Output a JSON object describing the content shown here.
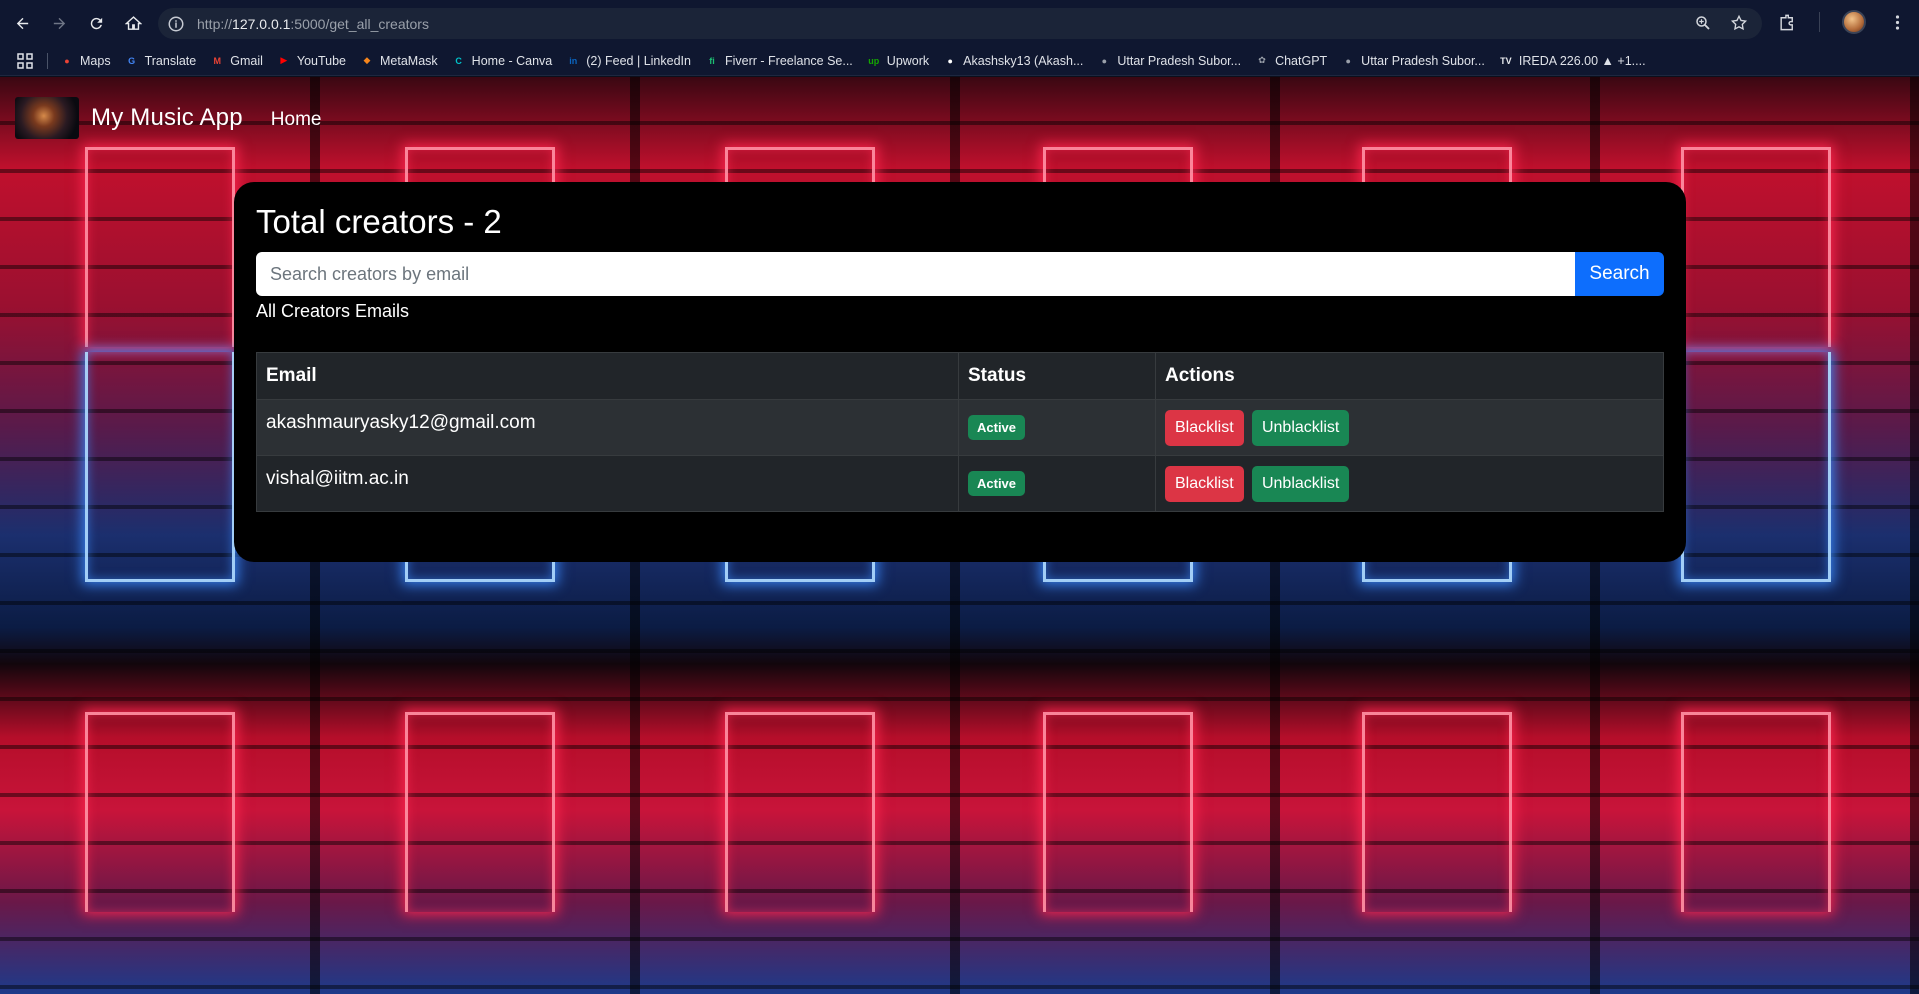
{
  "browser": {
    "url_prefix": "http://",
    "url_host": "127.0.0.1",
    "url_rest": ":5000/get_all_creators",
    "bookmarks": [
      {
        "label": "Maps",
        "color": "#ea4335",
        "glyph": "●"
      },
      {
        "label": "Translate",
        "color": "#4285f4",
        "glyph": "G"
      },
      {
        "label": "Gmail",
        "color": "#ea4335",
        "glyph": "M"
      },
      {
        "label": "YouTube",
        "color": "#ff0000",
        "glyph": "▶"
      },
      {
        "label": "MetaMask",
        "color": "#f6851b",
        "glyph": "◆"
      },
      {
        "label": "Home - Canva",
        "color": "#00c4cc",
        "glyph": "C"
      },
      {
        "label": "(2) Feed | LinkedIn",
        "color": "#0a66c2",
        "glyph": "in"
      },
      {
        "label": "Fiverr - Freelance Se...",
        "color": "#1dbf73",
        "glyph": "fi"
      },
      {
        "label": "Upwork",
        "color": "#14a800",
        "glyph": "up"
      },
      {
        "label": "Akashsky13 (Akash...",
        "color": "#ffffff",
        "glyph": "●"
      },
      {
        "label": "Uttar Pradesh Subor...",
        "color": "#9aa0aa",
        "glyph": "●"
      },
      {
        "label": "ChatGPT",
        "color": "#9aa0aa",
        "glyph": "✿"
      },
      {
        "label": "Uttar Pradesh Subor...",
        "color": "#9aa0aa",
        "glyph": "●"
      },
      {
        "label": "IREDA 226.00 ▲ +1....",
        "color": "#e8eaed",
        "glyph": "TV"
      }
    ]
  },
  "nav": {
    "brand": "My Music App",
    "home": "Home"
  },
  "main": {
    "title": "Total creators - 2",
    "search_placeholder": "Search creators by email",
    "search_button": "Search",
    "subtitle": "All Creators Emails",
    "columns": [
      "Email",
      "Status",
      "Actions"
    ],
    "rows": [
      {
        "email": "akashmauryasky12@gmail.com",
        "status": "Active",
        "blacklist": "Blacklist",
        "unblacklist": "Unblacklist"
      },
      {
        "email": "vishal@iitm.ac.in",
        "status": "Active",
        "blacklist": "Blacklist",
        "unblacklist": "Unblacklist"
      }
    ]
  },
  "colors": {
    "primary": "#0d6efd",
    "danger": "#dc3545",
    "success": "#198754"
  }
}
